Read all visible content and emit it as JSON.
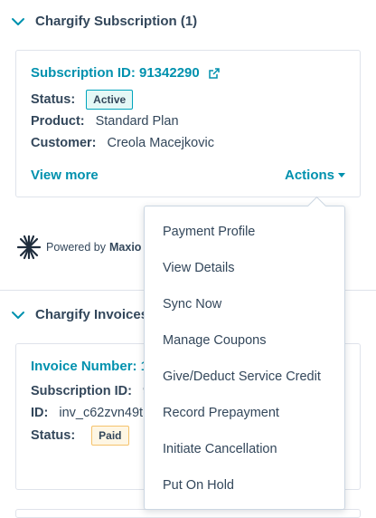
{
  "subscription_section": {
    "title": "Chargify Subscription (1)",
    "subscription_id_link": "Subscription ID: 91342290",
    "status_label": "Status:",
    "status_value": "Active",
    "product_label": "Product:",
    "product_value": "Standard Plan",
    "customer_label": "Customer:",
    "customer_value": "Creola Macejkovic",
    "view_more": "View more",
    "actions": "Actions"
  },
  "powered_by": {
    "prefix": "Powered by",
    "brand": "Maxio"
  },
  "invoices_section": {
    "title": "Chargify Invoices",
    "invoice_number_link": "Invoice Number: 1",
    "subscription_id_label": "Subscription ID:",
    "subscription_id_value": "9",
    "id_label": "ID:",
    "id_value": "inv_c62zvn49t",
    "status_label": "Status:",
    "status_value": "Paid"
  },
  "actions_menu": {
    "items": [
      "Payment Profile",
      "View Details",
      "Sync Now",
      "Manage Coupons",
      "Give/Deduct Service Credit",
      "Record Prepayment",
      "Initiate Cancellation",
      "Put On Hold"
    ]
  },
  "colors": {
    "link": "#0091ae",
    "text": "#33475b",
    "border": "#dfe3eb",
    "badge_bg": "#e5f8f6",
    "badge_border": "#00a4bd"
  },
  "icons": {
    "collapse": "chevron-down-icon",
    "external": "external-link-icon",
    "caret": "caret-down-icon",
    "logo": "maxio-logo-icon"
  }
}
